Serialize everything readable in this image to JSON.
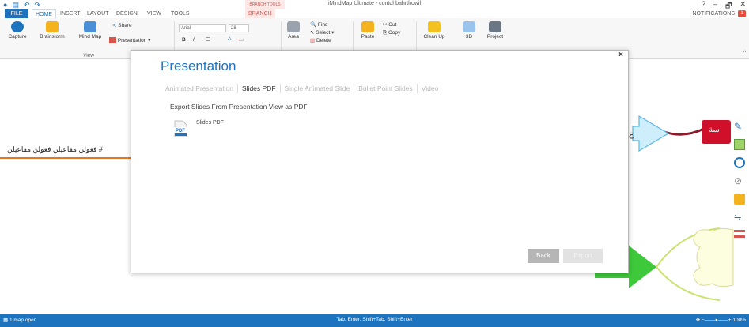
{
  "app": {
    "title": "iMindMap Ultimate - contohbahrthowil",
    "contextual_tab": "BRANCH TOOLS",
    "notifications_label": "NOTIFICATIONS",
    "notifications_count": "1",
    "window_controls": [
      "?",
      "–",
      "🗗",
      "✕"
    ]
  },
  "tabs": [
    "FILE",
    "HOME",
    "INSERT",
    "LAYOUT",
    "DESIGN",
    "VIEW",
    "TOOLS",
    "BRANCH"
  ],
  "ribbon": {
    "capture": "Capture",
    "brainstorm": "Brainstorm",
    "mind_map": "Mind Map",
    "share": "Share",
    "presentation": "Presentation ▾",
    "group_view": "View",
    "font_name": "Arial",
    "font_size": "28",
    "bold": "B",
    "italic": "I",
    "area": "Area",
    "find": "Find",
    "select": "Select ▾",
    "delete": "Delete",
    "paste": "Paste",
    "cut": "Cut",
    "copy": "Copy",
    "clean_up": "Clean Up",
    "three_d": "3D",
    "project": "Project"
  },
  "canvas": {
    "arabic_text": "# فعولن مفاعيلن فعولن مفاعيلن",
    "node_fragment_1": "ع",
    "node_fragment_2": "سة"
  },
  "status": {
    "maps_open": "1 map open",
    "hint": "Tab, Enter, Shift+Tab, Shift+Enter",
    "zoom": "100%"
  },
  "modal": {
    "title": "Presentation",
    "close": "×",
    "tabs": [
      {
        "label": "Animated Presentation",
        "active": false
      },
      {
        "label": "Slides PDF",
        "active": true
      },
      {
        "label": "Single Animated Slide",
        "active": false
      },
      {
        "label": "Bullet Point Slides",
        "active": false
      },
      {
        "label": "Video",
        "active": false
      }
    ],
    "section_title": "Export Slides From Presentation View as PDF",
    "item_label": "Slides PDF",
    "pdf_badge": "PDF",
    "back": "Back",
    "export": "Export"
  },
  "colors": {
    "accent": "#1e73be",
    "branch_tab": "#d9534f",
    "arrow_node": "#cfeefc",
    "red_node": "#d0102a",
    "green_node": "#3ec93a",
    "yellow_node": "#fdfde0"
  }
}
